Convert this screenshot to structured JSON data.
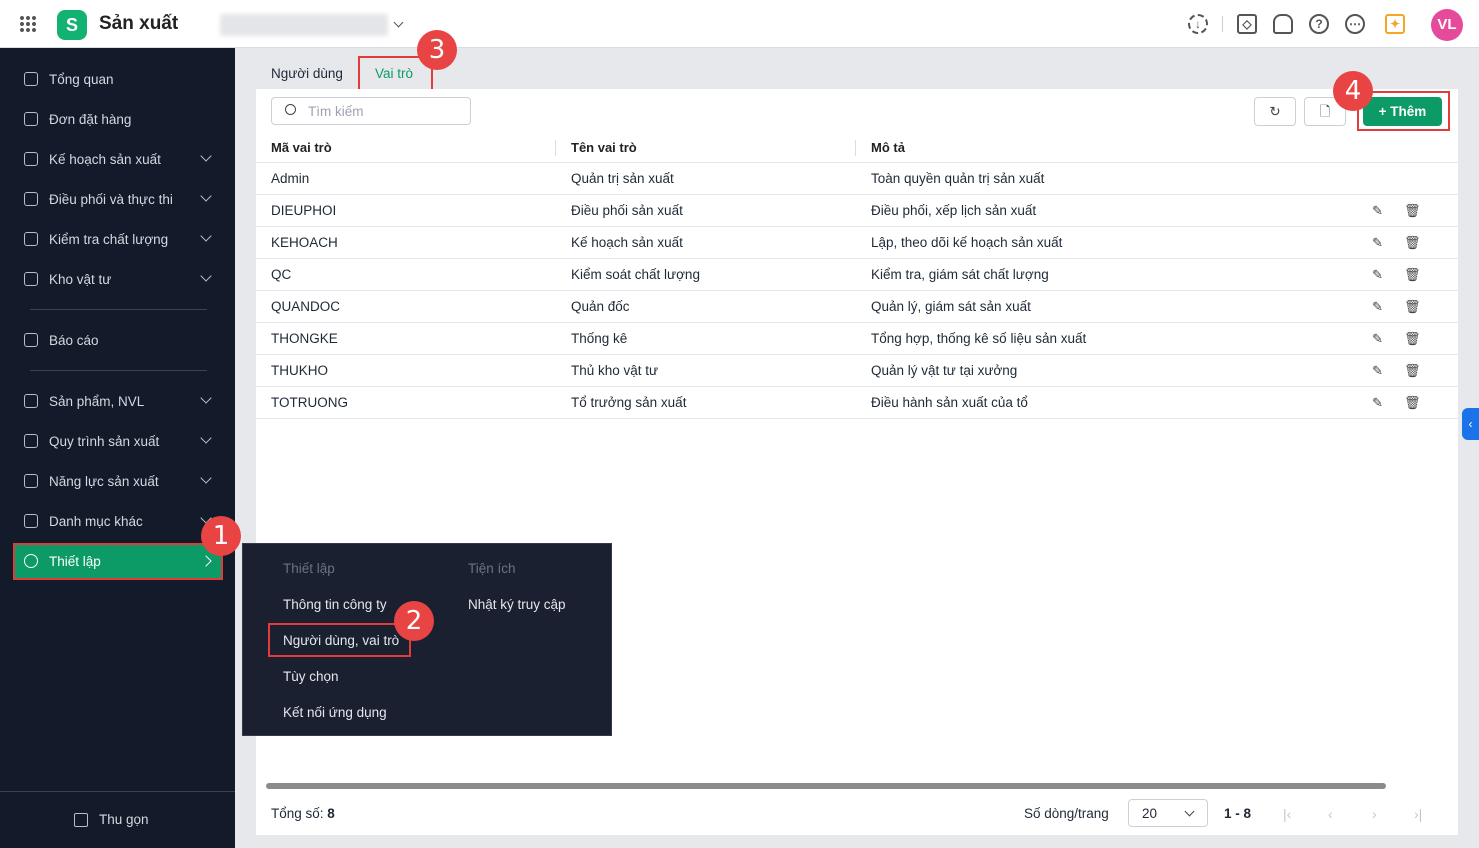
{
  "header": {
    "app_title": "Sản xuất",
    "avatar": "VL",
    "icons": [
      "apps-grid-icon",
      "download-icon",
      "box-icon",
      "bell-icon",
      "help-icon",
      "more-icon",
      "idea-book-icon"
    ]
  },
  "sidebar": {
    "items": [
      {
        "label": "Tổng quan",
        "chevron": false
      },
      {
        "label": "Đơn đặt hàng",
        "chevron": false
      },
      {
        "label": "Kế hoạch sản xuất",
        "chevron": true
      },
      {
        "label": "Điều phối và thực thi",
        "chevron": true
      },
      {
        "label": "Kiểm tra chất lượng",
        "chevron": true
      },
      {
        "label": "Kho vật tư",
        "chevron": true
      },
      {
        "label": "Báo cáo",
        "chevron": false
      },
      {
        "label": "Sản phẩm, NVL",
        "chevron": true
      },
      {
        "label": "Quy trình sản xuất",
        "chevron": true
      },
      {
        "label": "Năng lực sản xuất",
        "chevron": true
      },
      {
        "label": "Danh mục khác",
        "chevron": true
      },
      {
        "label": "Thiết lập",
        "chevron": true,
        "active": true
      }
    ],
    "collapse_label": "Thu gọn"
  },
  "menu": {
    "col1_title": "Thiết lập",
    "col2_title": "Tiện ích",
    "col1": [
      "Thông tin công ty",
      "Người dùng, vai trò",
      "Tùy chọn",
      "Kết nối ứng dụng"
    ],
    "col2": [
      "Nhật ký truy cập"
    ]
  },
  "tabs": [
    {
      "label": "Người dùng"
    },
    {
      "label": "Vai trò",
      "active": true
    }
  ],
  "toolbar": {
    "search_placeholder": "Tìm kiếm",
    "add_label": "+ Thêm"
  },
  "table": {
    "headers": [
      "Mã vai trò",
      "Tên vai trò",
      "Mô tả"
    ],
    "rows": [
      [
        "Admin",
        "Quản trị sản xuất",
        "Toàn quyền quản trị sản xuất"
      ],
      [
        "DIEUPHOI",
        "Điều phối sản xuất",
        "Điều phối, xếp lịch sản xuất"
      ],
      [
        "KEHOACH",
        "Kế hoạch sản xuất",
        "Lập, theo dõi kế hoạch sản xuất"
      ],
      [
        "QC",
        "Kiểm soát chất lượng",
        "Kiểm tra, giám sát chất lượng"
      ],
      [
        "QUANDOC",
        "Quản đốc",
        "Quản lý, giám sát sản xuất"
      ],
      [
        "THONGKE",
        "Thống kê",
        "Tổng hợp, thống kê số liệu sản xuất"
      ],
      [
        "THUKHO",
        "Thủ kho vật tư",
        "Quản lý vật tư tại xưởng"
      ],
      [
        "TOTRUONG",
        "Tổ trưởng sản xuất",
        "Điều hành sản xuất của tổ"
      ]
    ]
  },
  "footer": {
    "total_label": "Tổng số:",
    "total": "8",
    "rows_per_page_label": "Số dòng/trang",
    "rows_per_page": "20",
    "range": "1 - 8"
  },
  "annotations": [
    "1",
    "2",
    "3",
    "4"
  ],
  "colors": {
    "accent": "#0c9b66",
    "sidebar": "#131a29",
    "annotation": "#e84444"
  }
}
